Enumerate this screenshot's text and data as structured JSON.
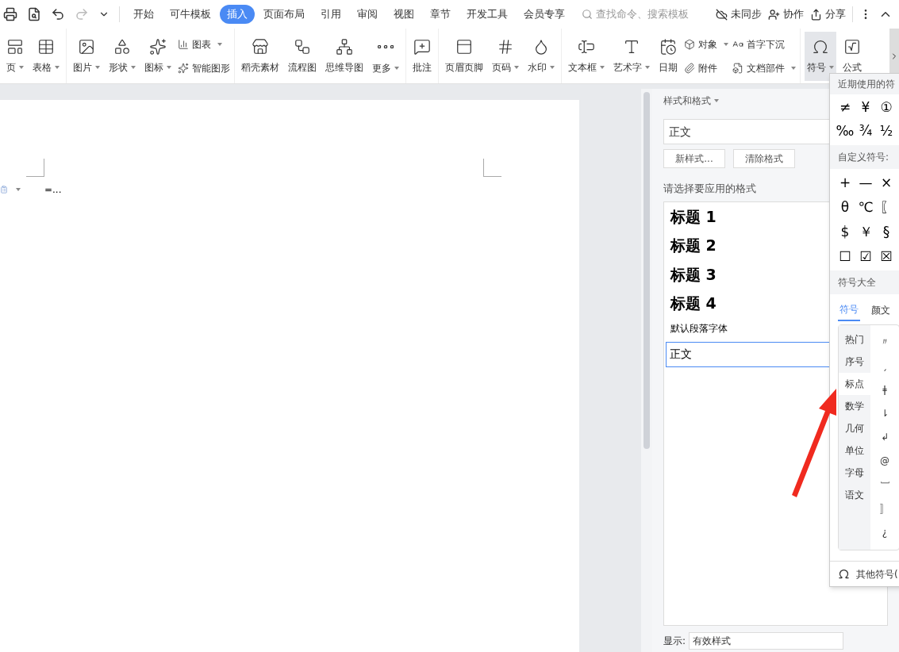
{
  "tabs": [
    {
      "label": "开始",
      "selected": false
    },
    {
      "label": "可牛模板",
      "selected": false
    },
    {
      "label": "插入",
      "selected": true
    },
    {
      "label": "页面布局",
      "selected": false
    },
    {
      "label": "引用",
      "selected": false
    },
    {
      "label": "审阅",
      "selected": false
    },
    {
      "label": "视图",
      "selected": false
    },
    {
      "label": "章节",
      "selected": false
    },
    {
      "label": "开发工具",
      "selected": false
    },
    {
      "label": "会员专享",
      "selected": false
    }
  ],
  "search": {
    "placeholder": "查找命令、搜索模板"
  },
  "actions": [
    {
      "label": "未同步"
    },
    {
      "label": "协作"
    },
    {
      "label": "分享"
    }
  ],
  "ribbon_groups": [
    [
      {
        "kind": "large",
        "label": "页",
        "dropdown": true,
        "pressed": false
      },
      {
        "kind": "large",
        "label": "表格",
        "dropdown": true,
        "pressed": false
      }
    ],
    [
      {
        "kind": "large",
        "label": "图片",
        "dropdown": true,
        "pressed": false
      },
      {
        "kind": "large",
        "label": "形状",
        "dropdown": true,
        "pressed": false
      },
      {
        "kind": "large",
        "label": "图标",
        "dropdown": true,
        "pressed": false
      },
      {
        "kind": "stack",
        "items": [
          {
            "label": "图表",
            "dropdown": true
          },
          {
            "label": "智能图形",
            "dropdown": false
          }
        ]
      }
    ],
    [
      {
        "kind": "large",
        "label": "稻壳素材",
        "dropdown": false,
        "pressed": false
      },
      {
        "kind": "large",
        "label": "流程图",
        "dropdown": false,
        "pressed": false
      },
      {
        "kind": "large",
        "label": "思维导图",
        "dropdown": false,
        "pressed": false
      },
      {
        "kind": "large",
        "label": "更多",
        "dropdown": true,
        "pressed": false
      }
    ],
    [
      {
        "kind": "large",
        "label": "批注",
        "dropdown": false,
        "pressed": false
      }
    ],
    [
      {
        "kind": "large",
        "label": "页眉页脚",
        "dropdown": false,
        "pressed": false
      },
      {
        "kind": "large",
        "label": "页码",
        "dropdown": true,
        "pressed": false
      },
      {
        "kind": "large",
        "label": "水印",
        "dropdown": true,
        "pressed": false
      }
    ],
    [
      {
        "kind": "large",
        "label": "文本框",
        "dropdown": true,
        "pressed": false
      },
      {
        "kind": "large",
        "label": "艺术字",
        "dropdown": true,
        "pressed": false
      },
      {
        "kind": "large",
        "label": "日期",
        "dropdown": false,
        "pressed": false
      },
      {
        "kind": "stack",
        "items": [
          {
            "label": "对象",
            "dropdown": true
          },
          {
            "label": "附件",
            "dropdown": false
          }
        ]
      },
      {
        "kind": "stack",
        "items": [
          {
            "label": "首字下沉",
            "dropdown": false
          },
          {
            "label": "文档部件",
            "dropdown": true
          }
        ]
      }
    ],
    [
      {
        "kind": "large",
        "label": "符号",
        "dropdown": true,
        "pressed": true
      },
      {
        "kind": "large",
        "label": "公式",
        "dropdown": false,
        "pressed": false
      }
    ]
  ],
  "document": {
    "text": "=..."
  },
  "styles_panel": {
    "title": "样式和格式",
    "current_style": "正文",
    "buttons": [
      "新样式...",
      "清除格式"
    ],
    "prompt": "请选择要应用的格式",
    "styles": [
      {
        "kind": "heading",
        "label": "标题 1",
        "selected": false
      },
      {
        "kind": "heading",
        "label": "标题 2",
        "selected": false
      },
      {
        "kind": "heading",
        "label": "标题 3",
        "selected": false
      },
      {
        "kind": "heading",
        "label": "标题 4",
        "selected": false
      },
      {
        "kind": "plain",
        "label": "默认段落字体",
        "selected": false
      },
      {
        "kind": "paragraph",
        "label": "正文",
        "selected": true
      }
    ],
    "show_label": "显示:",
    "show_value": "有效样式"
  },
  "symbol_menu": {
    "recent_title": "近期使用的符",
    "recent": [
      "≠",
      "¥",
      "①",
      "‰",
      "¾",
      "½"
    ],
    "custom_title": "自定义符号:",
    "custom": [
      "+",
      "—",
      "×",
      "θ",
      "℃",
      "〖",
      "$",
      "￥",
      "§",
      "☐",
      "☑",
      "☒"
    ],
    "all_title": "符号大全",
    "tabs": [
      {
        "label": "符号",
        "selected": true
      },
      {
        "label": "颜文",
        "selected": false
      }
    ],
    "categories": [
      {
        "label": "热门",
        "selected": false
      },
      {
        "label": "序号",
        "selected": false
      },
      {
        "label": "标点",
        "selected": true
      },
      {
        "label": "数学",
        "selected": false
      },
      {
        "label": "几何",
        "selected": false
      },
      {
        "label": "单位",
        "selected": false
      },
      {
        "label": "字母",
        "selected": false
      },
      {
        "label": "语文",
        "selected": false
      }
    ],
    "symbols": [
      "〃",
      "ˏ",
      "ǂ",
      "⇂",
      "↲",
      "@",
      "﹇",
      "〛",
      "¿"
    ],
    "more": "其他符号("
  }
}
